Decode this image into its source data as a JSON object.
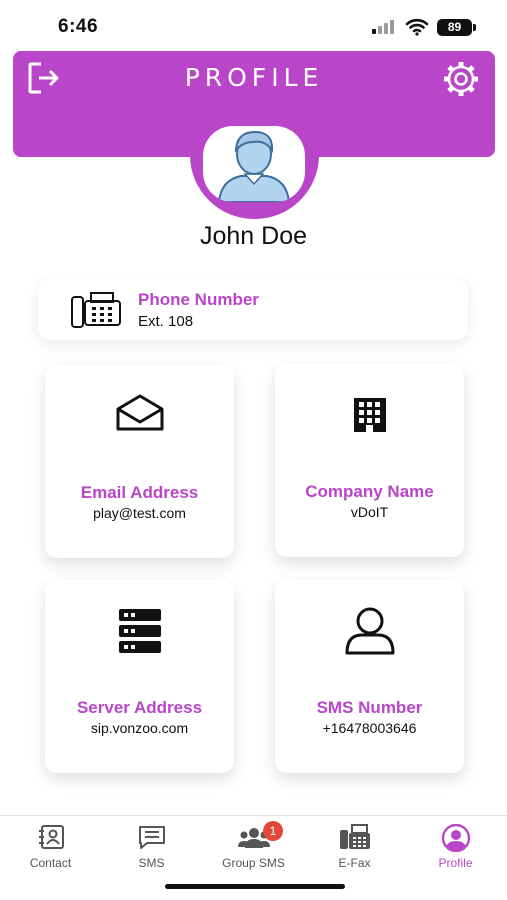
{
  "status_bar": {
    "time": "6:46",
    "battery": "89"
  },
  "header": {
    "title": "PROFILE",
    "logout_icon": "logout-icon",
    "settings_icon": "gear-icon",
    "accent_color": "#b945c8"
  },
  "profile": {
    "name": "John Doe",
    "avatar_icon": "user-avatar-icon"
  },
  "phone": {
    "title": "Phone Number",
    "value": "Ext. 108",
    "icon": "fax-phone-icon"
  },
  "cards": [
    {
      "title": "Email Address",
      "value": "play@test.com",
      "icon": "envelope-open-icon"
    },
    {
      "title": "Company Name",
      "value": "vDoIT",
      "icon": "building-icon"
    },
    {
      "title": "Server Address",
      "value": "sip.vonzoo.com",
      "icon": "server-icon"
    },
    {
      "title": "SMS Number",
      "value": "+16478003646",
      "icon": "user-outline-icon"
    }
  ],
  "tabs": [
    {
      "label": "Contact",
      "icon": "contact-card-icon"
    },
    {
      "label": "SMS",
      "icon": "message-icon"
    },
    {
      "label": "Group SMS",
      "icon": "group-icon",
      "badge": "1"
    },
    {
      "label": "E-Fax",
      "icon": "fax-icon"
    },
    {
      "label": "Profile",
      "icon": "profile-icon",
      "active": true
    }
  ]
}
